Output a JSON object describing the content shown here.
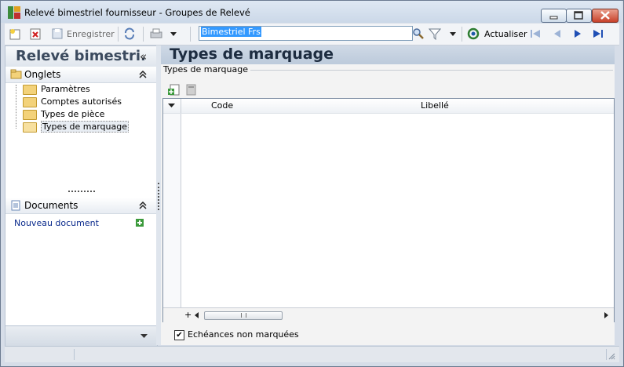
{
  "window": {
    "title": "Relevé bimestriel fournisseur -  Groupes de Relevé"
  },
  "toolbar": {
    "save_label": "Enregistrer",
    "search_value": "Bimestriel Frs",
    "refresh_label": "Actualiser"
  },
  "left_pane": {
    "title": "Relevé bimestri.",
    "collapse_glyph": "«",
    "onglets_label": "Onglets",
    "onglets_items": [
      "Paramètres",
      "Comptes autorisés",
      "Types de pièce",
      "Types de marquage"
    ],
    "selected_item": "Types de marquage",
    "documents_label": "Documents",
    "new_document_label": "Nouveau document"
  },
  "right_pane": {
    "title": "Types de marquage",
    "group_label": "Types de marquage",
    "grid": {
      "columns": [
        "Code",
        "Libellé"
      ],
      "rows": []
    },
    "checkbox_label": "Echéances non marquées",
    "checkbox_checked": true
  },
  "colors": {
    "accent": "#3399ff",
    "link": "#0a2a8c",
    "header_text": "#1d2c40"
  }
}
